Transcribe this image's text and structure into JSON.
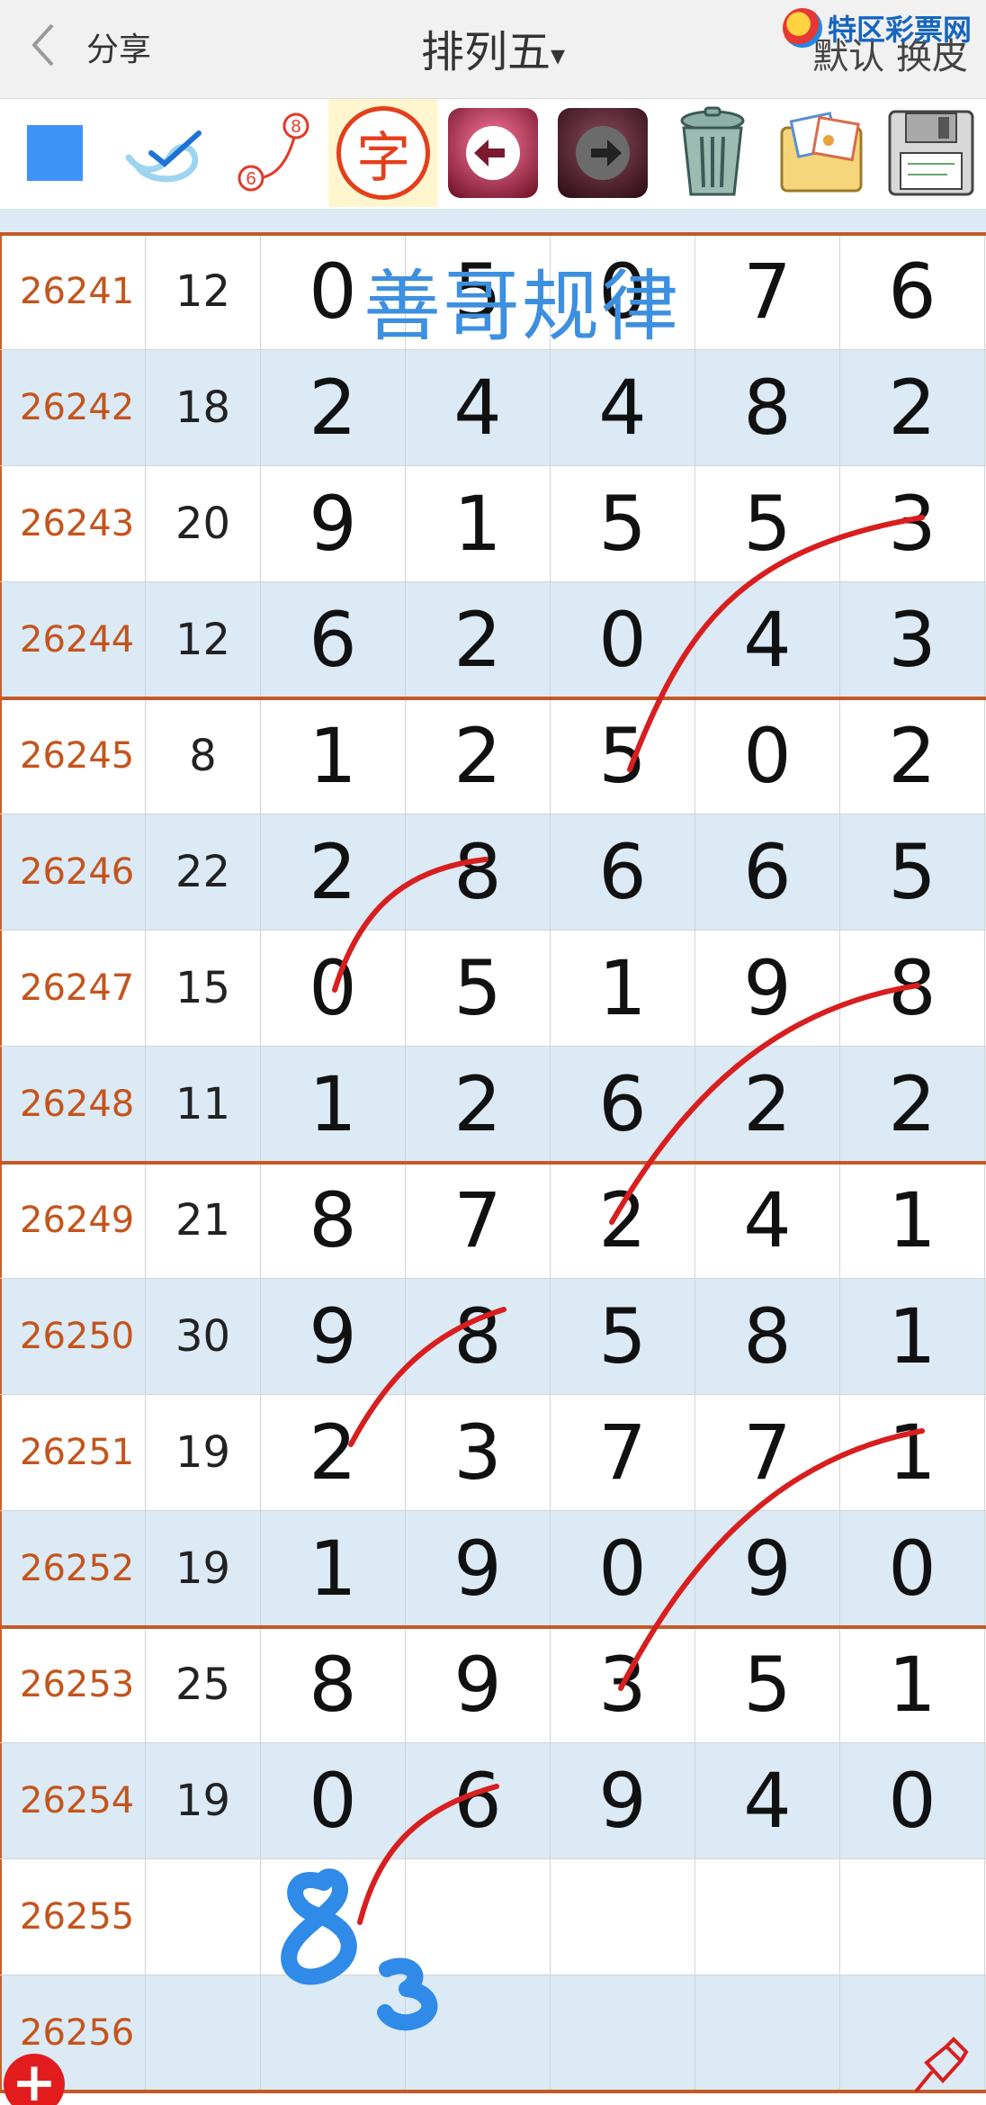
{
  "header": {
    "back_icon": "chevron-left-icon",
    "share_label": "分享",
    "title": "排列五",
    "title_caret": "▾",
    "right_label": "默认 换皮",
    "brand_text": "特区彩票网"
  },
  "toolbar": {
    "tools": [
      {
        "name": "square-tool-icon"
      },
      {
        "name": "pen-tool-icon"
      },
      {
        "name": "connect-numbers-icon",
        "from": "6",
        "to": "8"
      },
      {
        "name": "character-tool-icon",
        "label": "字"
      },
      {
        "name": "undo-icon"
      },
      {
        "name": "redo-icon"
      },
      {
        "name": "trash-icon"
      },
      {
        "name": "photo-album-icon"
      },
      {
        "name": "save-icon"
      }
    ]
  },
  "watermark": "善哥规律",
  "rows": [
    {
      "issue": "26241",
      "sum": "12",
      "digits": [
        "0",
        "5",
        "0",
        "7",
        "6"
      ]
    },
    {
      "issue": "26242",
      "sum": "18",
      "digits": [
        "2",
        "4",
        "4",
        "8",
        "2"
      ]
    },
    {
      "issue": "26243",
      "sum": "20",
      "digits": [
        "9",
        "1",
        "5",
        "5",
        "3"
      ]
    },
    {
      "issue": "26244",
      "sum": "12",
      "digits": [
        "6",
        "2",
        "0",
        "4",
        "3"
      ]
    },
    {
      "issue": "26245",
      "sum": "8",
      "digits": [
        "1",
        "2",
        "5",
        "0",
        "2"
      ]
    },
    {
      "issue": "26246",
      "sum": "22",
      "digits": [
        "2",
        "8",
        "6",
        "6",
        "5"
      ]
    },
    {
      "issue": "26247",
      "sum": "15",
      "digits": [
        "0",
        "5",
        "1",
        "9",
        "8"
      ]
    },
    {
      "issue": "26248",
      "sum": "11",
      "digits": [
        "1",
        "2",
        "6",
        "2",
        "2"
      ]
    },
    {
      "issue": "26249",
      "sum": "21",
      "digits": [
        "8",
        "7",
        "2",
        "4",
        "1"
      ]
    },
    {
      "issue": "26250",
      "sum": "30",
      "digits": [
        "9",
        "8",
        "5",
        "8",
        "1"
      ]
    },
    {
      "issue": "26251",
      "sum": "19",
      "digits": [
        "2",
        "3",
        "7",
        "7",
        "1"
      ]
    },
    {
      "issue": "26252",
      "sum": "19",
      "digits": [
        "1",
        "9",
        "0",
        "9",
        "0"
      ]
    },
    {
      "issue": "26253",
      "sum": "25",
      "digits": [
        "8",
        "9",
        "3",
        "5",
        "1"
      ]
    },
    {
      "issue": "26254",
      "sum": "19",
      "digits": [
        "0",
        "6",
        "9",
        "4",
        "0"
      ]
    },
    {
      "issue": "26255",
      "sum": "",
      "digits": [
        "",
        "",
        "",
        "",
        ""
      ]
    },
    {
      "issue": "26256",
      "sum": "",
      "digits": [
        "",
        "",
        "",
        "",
        ""
      ]
    }
  ],
  "handwriting": {
    "text": "83",
    "color": "#2f8ae8"
  },
  "colors": {
    "issue_text": "#c4541c",
    "row_alt": "#dbeaf5",
    "group_divider": "#c35a28",
    "stroke": "#d81e1e",
    "watermark": "#3d8fe0"
  }
}
